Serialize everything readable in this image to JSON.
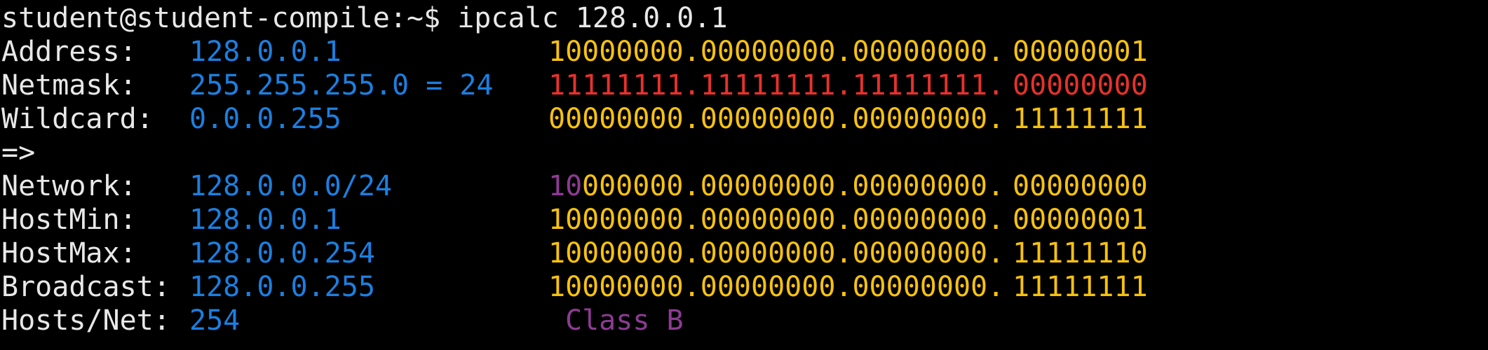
{
  "terminal": {
    "colors": {
      "text": "#e8e8e8",
      "value": "#1c7fe0",
      "binary": "#f6c20f",
      "mask": "#e8312b",
      "class": "#8e3b93",
      "background": "#000000"
    },
    "prompt": "student@student-compile:~$ ipcalc 128.0.0.1",
    "rows": {
      "address": {
        "label": "Address:",
        "value": "128.0.0.1",
        "bin_prefix": "10000000.00000000.00000000.",
        "bin_host": "00000001"
      },
      "netmask": {
        "label": "Netmask:",
        "value": "255.255.255.0 = 24",
        "bin_prefix": "11111111.11111111.11111111.",
        "bin_host": "00000000"
      },
      "wildcard": {
        "label": "Wildcard:",
        "value": "0.0.0.255",
        "bin_prefix": "00000000.00000000.00000000.",
        "bin_host": "11111111"
      },
      "arrow": {
        "label": "=>"
      },
      "network": {
        "label": "Network:",
        "value": "128.0.0.0/24",
        "class_bits": "10",
        "bin_prefix": "000000.00000000.00000000.",
        "bin_host": "00000000"
      },
      "hostmin": {
        "label": "HostMin:",
        "value": "128.0.0.1",
        "bin_prefix": "10000000.00000000.00000000.",
        "bin_host": "00000001"
      },
      "hostmax": {
        "label": "HostMax:",
        "value": "128.0.0.254",
        "bin_prefix": "10000000.00000000.00000000.",
        "bin_host": "11111110"
      },
      "broadcast": {
        "label": "Broadcast:",
        "value": "128.0.0.255",
        "bin_prefix": "10000000.00000000.00000000.",
        "bin_host": "11111111"
      },
      "hosts": {
        "label": "Hosts/Net:",
        "value": "254",
        "class_label": "Class B"
      }
    }
  }
}
